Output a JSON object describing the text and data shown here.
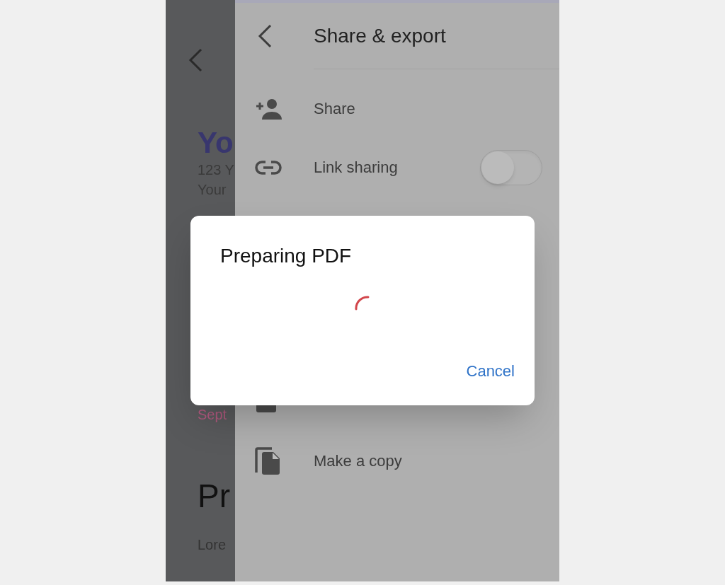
{
  "document": {
    "texts": [
      {
        "kind": "heading",
        "text": "Yo"
      },
      {
        "kind": "address",
        "text": "123 Y"
      },
      {
        "kind": "address",
        "text": "Your"
      },
      {
        "kind": "date",
        "text": "Sept"
      },
      {
        "kind": "section",
        "text": "Pr"
      },
      {
        "kind": "body",
        "text": "Lore"
      }
    ]
  },
  "share_panel": {
    "title": "Share & export",
    "items_top": [
      {
        "kind": "share",
        "label": "Share"
      },
      {
        "kind": "link",
        "label": "Link sharing",
        "on": false
      }
    ],
    "items_bottom": [
      {
        "kind": "word"
      },
      {
        "kind": "copy",
        "label": "Make a copy"
      }
    ]
  },
  "dialog": {
    "title": "Preparing PDF",
    "button": "Cancel"
  }
}
